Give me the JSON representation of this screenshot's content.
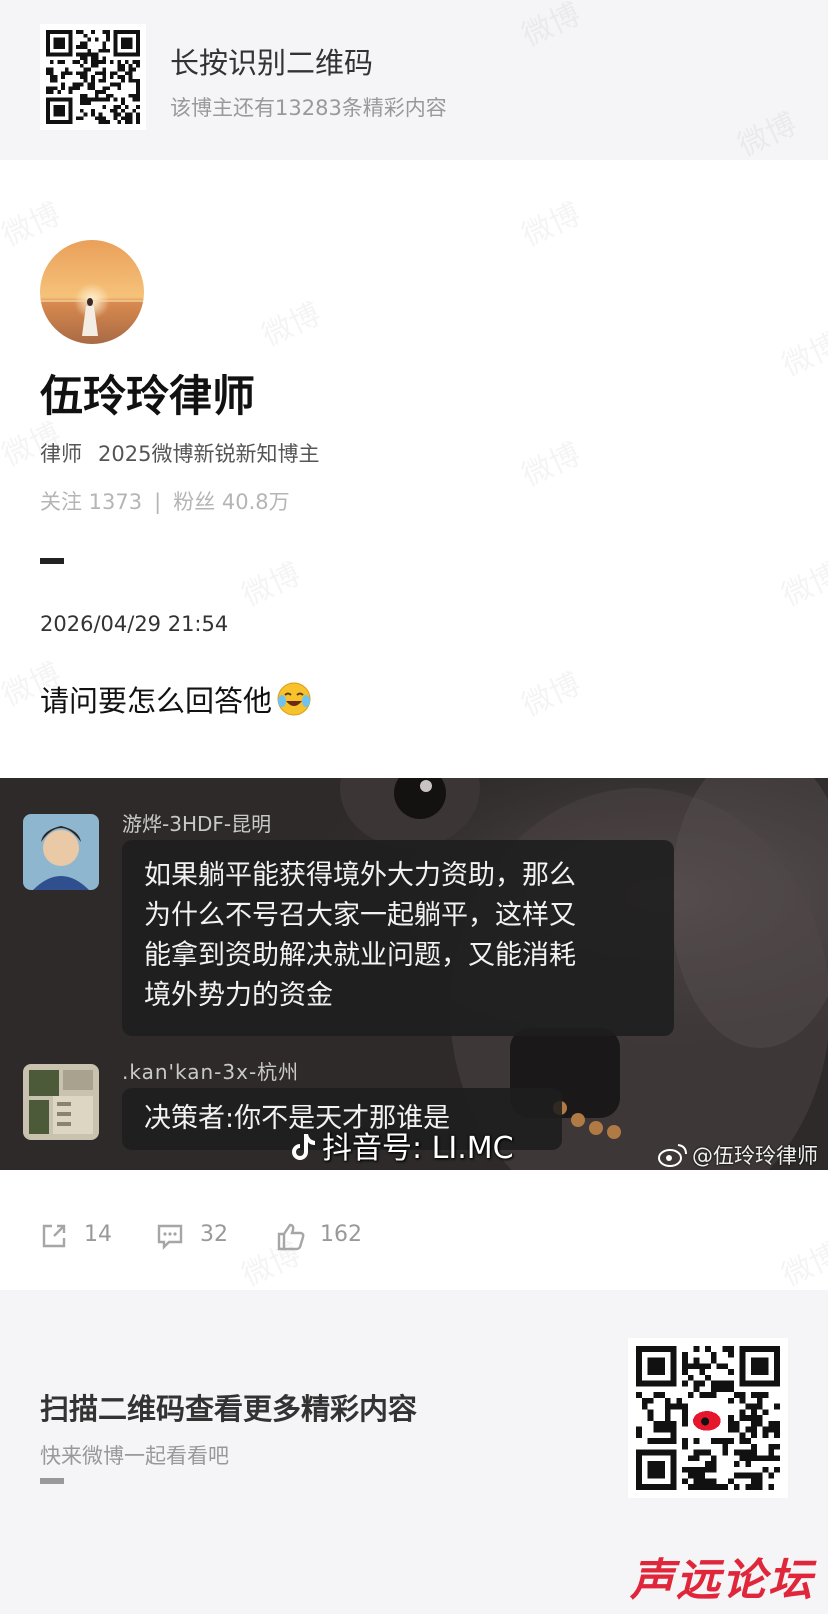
{
  "top_banner": {
    "title": "长按识别二维码",
    "subtitle": "该博主还有13283条精彩内容"
  },
  "profile": {
    "name": "伍玲玲律师",
    "tags": [
      "律师",
      "2025微博新锐新知博主"
    ],
    "following_label": "关注 1373",
    "followers_label": "粉丝 40.8万",
    "separator": "|"
  },
  "post": {
    "time": "2026/04/29 21:54",
    "text": "请问要怎么回答他",
    "image": {
      "comment_1": {
        "user": "游烨-3HDF-昆明",
        "lines": [
          "如果躺平能获得境外大力资助，那么",
          "为什么不号召大家一起躺平，这样又",
          "能拿到资助解决就业问题，又能消耗",
          "境外势力的资金"
        ]
      },
      "comment_2": {
        "user": ".kan'kan-3x-杭州",
        "text": "决策者:你不是天才那谁是"
      },
      "douyin_watermark": "抖音号: LI.MC",
      "weibo_watermark": "@伍玲玲律师"
    }
  },
  "actions": {
    "share_count": "14",
    "comment_count": "32",
    "like_count": "162"
  },
  "bottom_banner": {
    "title": "扫描二维码查看更多精彩内容",
    "subtitle": "快来微博一起看看吧"
  },
  "watermark_text": "微博",
  "forum_logo": "声远论坛",
  "colors": {
    "banner_bg": "#f5f5f7",
    "weibo_red": "#e6162d",
    "forum_red": "#e0263b"
  }
}
